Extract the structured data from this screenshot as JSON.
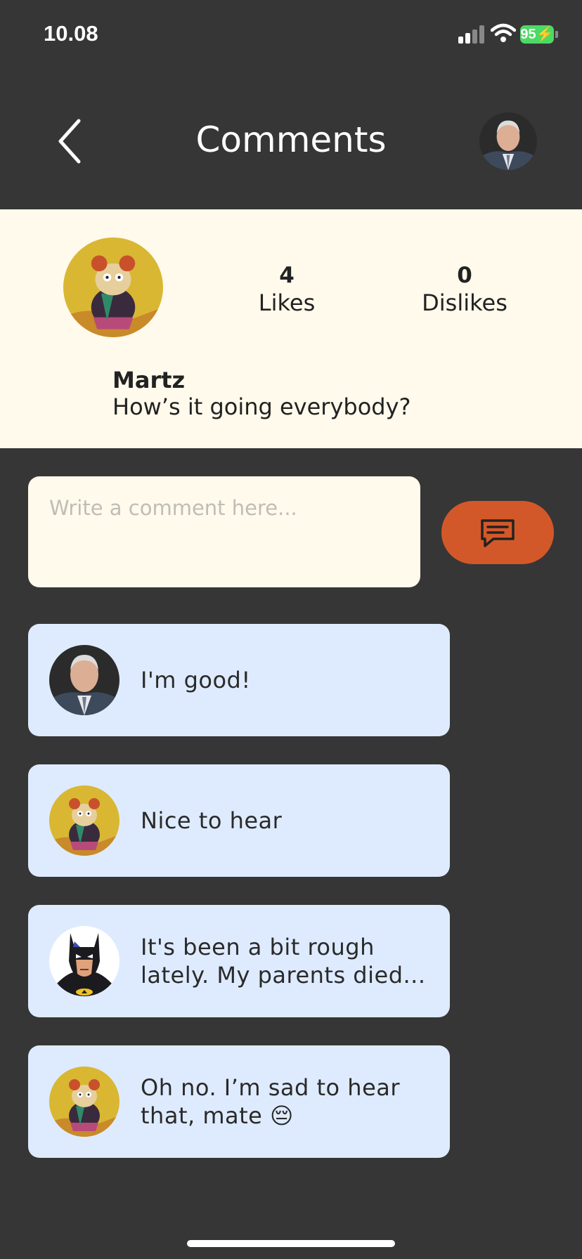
{
  "status": {
    "time": "10.08",
    "battery": "95"
  },
  "header": {
    "title": "Comments"
  },
  "post": {
    "author": "Martz",
    "text": "How’s it going everybody?",
    "likes_count": "4",
    "likes_label": "Likes",
    "dislikes_count": "0",
    "dislikes_label": "Dislikes"
  },
  "composer": {
    "placeholder": "Write a comment here..."
  },
  "comments": [
    {
      "text": "I'm good!",
      "avatar": "man-photo"
    },
    {
      "text": "Nice to hear",
      "avatar": "cartoon-creature"
    },
    {
      "text": "It's been a bit rough lately. My parents died...",
      "avatar": "batman"
    },
    {
      "text": "Oh no. I’m sad to hear that, mate 😔",
      "avatar": "cartoon-creature"
    }
  ],
  "colors": {
    "background": "#363636",
    "card": "#fffaec",
    "comment_bubble": "#deebff",
    "accent": "#d35829",
    "battery": "#4cd964"
  },
  "icons": {
    "back": "chevron-left-icon",
    "send": "message-icon",
    "signal": "cellular-signal-icon",
    "wifi": "wifi-icon",
    "battery": "battery-icon"
  }
}
